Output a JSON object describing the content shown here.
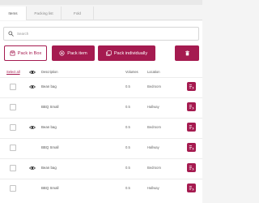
{
  "tabs": [
    {
      "label": "Items",
      "active": true
    },
    {
      "label": "Packing list",
      "active": false
    },
    {
      "label": "Fold",
      "active": false
    }
  ],
  "search": {
    "placeholder": "Search",
    "value": ""
  },
  "actions": {
    "pack_in_box": "Pack in Box",
    "pack_item": "Pack item",
    "pack_individually": "Pack individually",
    "delete_icon": "trash-icon"
  },
  "table": {
    "headers": {
      "select_all": "Select all",
      "description": "Description",
      "volumes": "Volumes",
      "location": "Location"
    },
    "rows": [
      {
        "eye": true,
        "description": "Bean bag",
        "volume": "0.5",
        "location": "Bedroom"
      },
      {
        "eye": false,
        "description": "BBQ Small",
        "volume": "0.5",
        "location": "Hallway"
      },
      {
        "eye": true,
        "description": "Bean bag",
        "volume": "0.5",
        "location": "Bedroom"
      },
      {
        "eye": false,
        "description": "BBQ Small",
        "volume": "0.5",
        "location": "Hallway"
      },
      {
        "eye": true,
        "description": "Bean bag",
        "volume": "0.5",
        "location": "Bedroom"
      },
      {
        "eye": false,
        "description": "BBQ Small",
        "volume": "0.5",
        "location": "Hallway"
      }
    ]
  },
  "colors": {
    "accent": "#a51b50",
    "panel": "#ffffff",
    "background": "#f4f4f4"
  }
}
